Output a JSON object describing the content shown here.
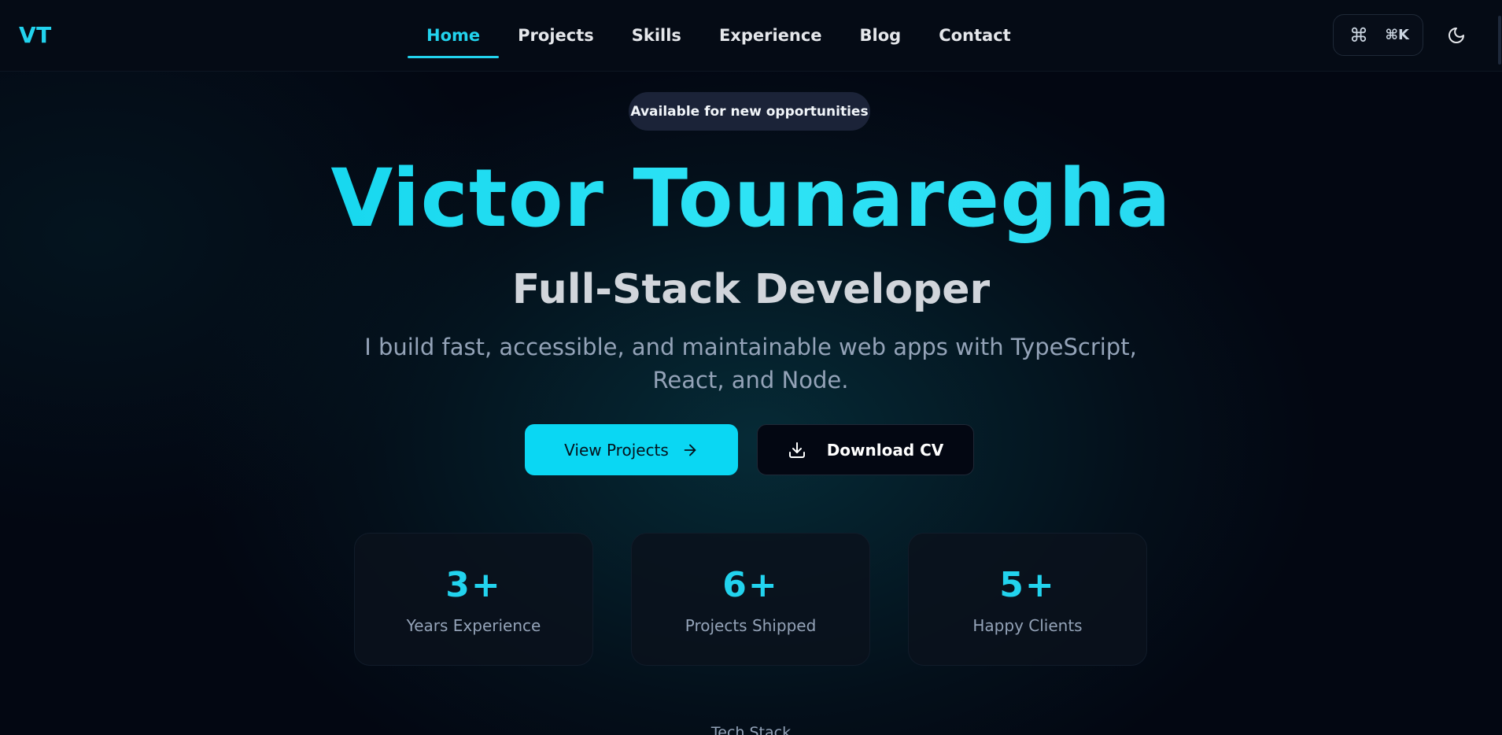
{
  "nav": {
    "logo": "VT",
    "links": [
      {
        "label": "Home",
        "active": true
      },
      {
        "label": "Projects",
        "active": false
      },
      {
        "label": "Skills",
        "active": false
      },
      {
        "label": "Experience",
        "active": false
      },
      {
        "label": "Blog",
        "active": false
      },
      {
        "label": "Contact",
        "active": false
      }
    ],
    "command_palette": {
      "icon": "command-icon",
      "shortcut": "⌘K"
    },
    "theme_toggle_icon": "moon-icon"
  },
  "hero": {
    "badge": "Available for new opportunities",
    "name": "Victor Tounaregha",
    "role": "Full-Stack Developer",
    "description": "I build fast, accessible, and maintainable web apps with TypeScript, React, and Node.",
    "primary_button": {
      "label": "View Projects",
      "icon": "arrow-right-icon"
    },
    "secondary_button": {
      "label": "Download CV",
      "icon": "download-icon"
    }
  },
  "stats": [
    {
      "value": "3+",
      "label": "Years Experience"
    },
    {
      "value": "6+",
      "label": "Projects Shipped"
    },
    {
      "value": "5+",
      "label": "Happy Clients"
    }
  ],
  "next_section": {
    "label": "Tech Stack"
  },
  "colors": {
    "accent": "#22d3ee",
    "background": "#030712",
    "badge_bg": "#1b2338",
    "muted_text": "#94a3b8"
  }
}
